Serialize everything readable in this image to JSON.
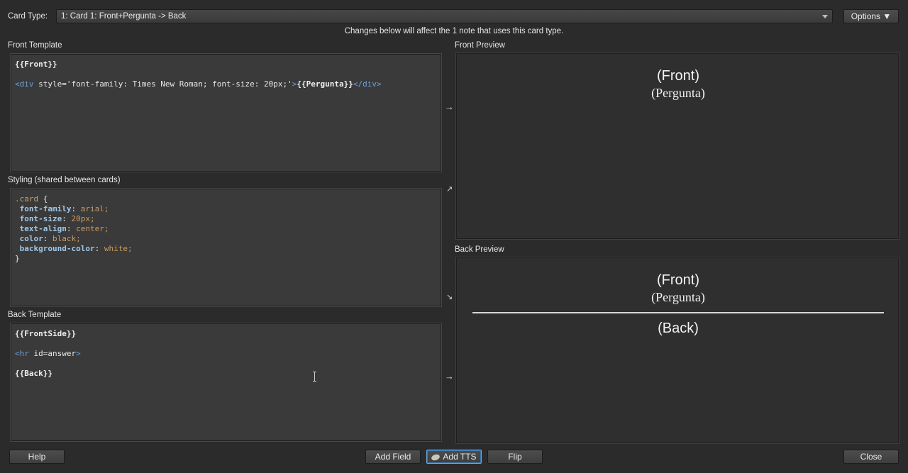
{
  "header": {
    "card_type_label": "Card Type:",
    "card_type_value": "1: Card 1: Front+Pergunta -> Back",
    "options_label": "Options ▼",
    "notice": "Changes below will affect the 1 note that uses this card type."
  },
  "sections": {
    "front_template_label": "Front Template",
    "styling_label": "Styling (shared between cards)",
    "back_template_label": "Back Template",
    "front_preview_label": "Front Preview",
    "back_preview_label": "Back Preview"
  },
  "front_template": {
    "line1": "{{Front}}",
    "line3_open_tag": "<div",
    "line3_attr": " style='font-family: Times New Roman; font-size: 20px;'",
    "line3_gt": ">",
    "line3_field": "{{Pergunta}}",
    "line3_close_tag": "</div>"
  },
  "styling": {
    "selector": ".card",
    "brace_open": " {",
    "props": [
      {
        "name": "font-family",
        "value": "arial;"
      },
      {
        "name": "font-size",
        "value": "20px;"
      },
      {
        "name": "text-align",
        "value": "center;"
      },
      {
        "name": "color",
        "value": "black;"
      },
      {
        "name": "background-color",
        "value": "white;"
      }
    ],
    "brace_close": "}"
  },
  "back_template": {
    "line1": "{{FrontSide}}",
    "line3_open_tag": "<hr",
    "line3_attr": " id=answer",
    "line3_gt": ">",
    "line5": "{{Back}}"
  },
  "front_preview": {
    "front": "(Front)",
    "pergunta": "(Pergunta)"
  },
  "back_preview": {
    "front": "(Front)",
    "pergunta": "(Pergunta)",
    "back": "(Back)"
  },
  "arrows": {
    "front": "→",
    "styling_up": "↗",
    "styling_down": "↘",
    "back": "→"
  },
  "footer": {
    "help": "Help",
    "add_field": "Add Field",
    "add_tts": "Add TTS",
    "flip": "Flip",
    "close": "Close"
  }
}
